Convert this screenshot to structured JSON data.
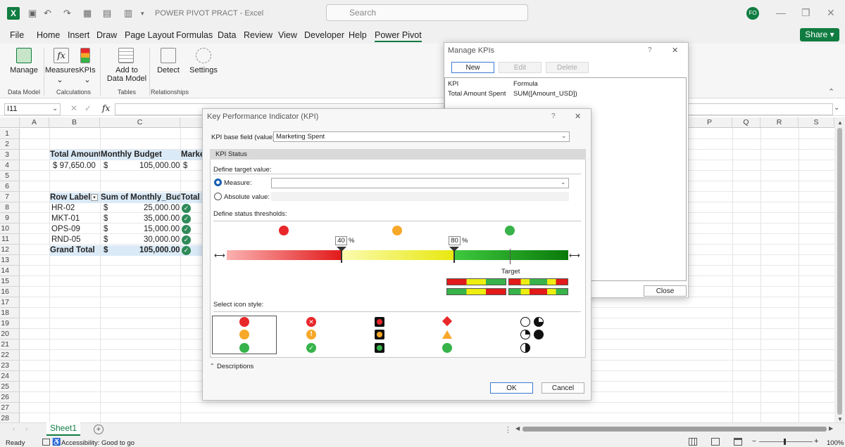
{
  "app": {
    "title": "POWER PIVOT PRACT  -  Excel",
    "search_placeholder": "Search",
    "avatar_initials": "FO",
    "share_label": "Share"
  },
  "menu": [
    "File",
    "Home",
    "Insert",
    "Draw",
    "Page Layout",
    "Formulas",
    "Data",
    "Review",
    "View",
    "Developer",
    "Help",
    "Power Pivot"
  ],
  "ribbon": {
    "buttons": {
      "manage": "Manage",
      "measures": "Measures",
      "kpis": "KPIs",
      "add_to": "Add to",
      "data_model": "Data Model",
      "detect": "Detect",
      "settings": "Settings"
    },
    "groups": {
      "data_model": "Data Model",
      "calculations": "Calculations",
      "tables": "Tables",
      "relationships": "Relationships"
    }
  },
  "formula_bar": {
    "name_box": "I11",
    "fx": "fx"
  },
  "columns": [
    "A",
    "B",
    "C",
    "",
    "",
    "",
    "",
    "",
    "",
    "",
    "",
    "",
    "",
    "P",
    "Q",
    "R",
    "S"
  ],
  "rows": [
    "1",
    "2",
    "3",
    "4",
    "5",
    "6",
    "7",
    "8",
    "9",
    "10",
    "11",
    "12",
    "13",
    "14",
    "15",
    "16",
    "17",
    "18",
    "19",
    "20",
    "21",
    "22",
    "23",
    "24",
    "25",
    "26",
    "27",
    "28"
  ],
  "sheet": {
    "b3": "Total Amount S",
    "c3": "Monthly Budget",
    "d3": "Market",
    "b4": "$ 97,650.00",
    "c4a": "$",
    "c4b": "105,000.00",
    "d4": "$",
    "b7": "Row Labels",
    "c7": "Sum of Monthly_Budget",
    "d7": "Total A",
    "rows": [
      {
        "label": "HR-02",
        "cur": "$",
        "value": "25,000.00"
      },
      {
        "label": "MKT-01",
        "cur": "$",
        "value": "35,000.00"
      },
      {
        "label": "OPS-09",
        "cur": "$",
        "value": "15,000.00"
      },
      {
        "label": "RND-05",
        "cur": "$",
        "value": "30,000.00"
      }
    ],
    "grand_label": "Grand Total",
    "grand_cur": "$",
    "grand_value": "105,000.00",
    "check_glyph": "✓"
  },
  "sheet_tab": "Sheet1",
  "status": {
    "ready": "Ready",
    "accessibility": "Accessibility: Good to go",
    "zoom": "100%"
  },
  "manage_kpis": {
    "title": "Manage KPIs",
    "help": "?",
    "close_x": "✕",
    "new": "New",
    "edit": "Edit",
    "delete": "Delete",
    "col_kpi": "KPI",
    "col_formula": "Formula",
    "row_kpi": "Total Amount Spent",
    "row_formula": "SUM([Amount_USD])",
    "close": "Close"
  },
  "kpi_dialog": {
    "title": "Key Performance Indicator (KPI)",
    "help": "?",
    "close_x": "✕",
    "base_field_label": "KPI base field (value):",
    "base_field_value": "Marketing Spent",
    "status_header": "KPI Status",
    "define_target": "Define target value:",
    "measure_label": "Measure:",
    "absolute_label": "Absolute value:",
    "thresholds_label": "Define status thresholds:",
    "threshold_low": "40",
    "threshold_high": "80",
    "percent": "%",
    "target_label": "Target",
    "icon_style_label": "Select icon style:",
    "descriptions_label": "Descriptions",
    "ok": "OK",
    "cancel": "Cancel"
  },
  "colors": {
    "red": "#e8272a",
    "amber": "#f7a829",
    "green": "#37b34a",
    "excel_green": "#107c41",
    "selection_blue": "#dbeaf7"
  }
}
